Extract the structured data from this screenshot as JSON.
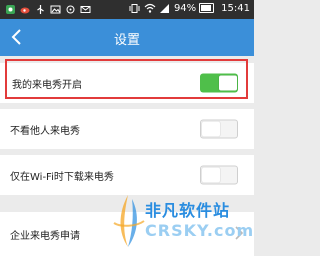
{
  "status_bar": {
    "battery": "94%",
    "time": "15:41",
    "icons": [
      "app-icon",
      "weibo-icon",
      "usb-icon",
      "image-icon",
      "location-icon",
      "mail-icon",
      "vibrate-icon",
      "wifi-icon",
      "signal-icon",
      "battery-icon"
    ]
  },
  "header": {
    "title": "设置",
    "back_icon": "chevron-left-icon"
  },
  "settings": [
    {
      "label": "我的来电秀开启",
      "toggle": true,
      "highlighted": true
    },
    {
      "label": "不看他人来电秀",
      "toggle": false
    },
    {
      "label": "仅在Wi-Fi时下载来电秀",
      "toggle": false
    },
    {
      "label": "企业来电秀申请",
      "arrow": true
    }
  ],
  "watermark": {
    "title": "非凡软件站",
    "domain": "CRSKY.com"
  },
  "colors": {
    "header": "#3b8fd9",
    "toggle_on": "#4fbf4a",
    "highlight": "#e23b3b",
    "background": "#ebebeb"
  }
}
